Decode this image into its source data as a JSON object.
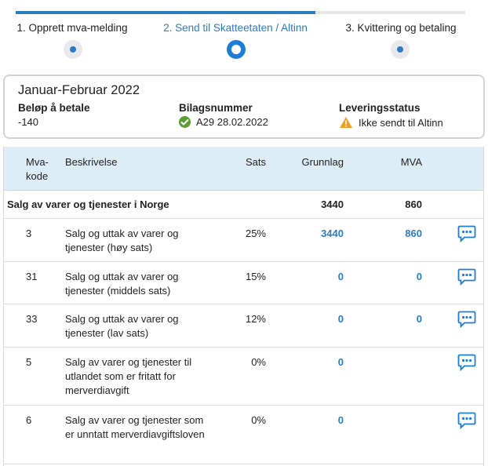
{
  "stepper": {
    "steps": [
      {
        "label": "1. Opprett mva-melding",
        "state": "done"
      },
      {
        "label": "2. Send til Skatteetaten / Altinn",
        "state": "active"
      },
      {
        "label": "3. Kvittering og betaling",
        "state": "todo"
      }
    ]
  },
  "summary": {
    "title": "Januar-Februar 2022",
    "amount_label": "Beløp å betale",
    "amount_value": "-140",
    "voucher_label": "Bilagsnummer",
    "voucher_value": "A29 28.02.2022",
    "delivery_label": "Leveringsstatus",
    "delivery_value": "Ikke sendt til Altinn"
  },
  "table": {
    "headers": {
      "kode_line1": "Mva-",
      "kode_line2": "kode",
      "beskrivelse": "Beskrivelse",
      "sats": "Sats",
      "grunnlag": "Grunnlag",
      "mva": "MVA"
    },
    "group": {
      "label": "Salg av varer og tjenester i Norge",
      "grunnlag": "3440",
      "mva": "860"
    },
    "rows": [
      {
        "kode": "3",
        "beskrivelse": "Salg og uttak av varer og tjenester (høy sats)",
        "sats": "25%",
        "grunnlag": "3440",
        "mva": "860"
      },
      {
        "kode": "31",
        "beskrivelse": "Salg og uttak av varer og tjenester (middels sats)",
        "sats": "15%",
        "grunnlag": "0",
        "mva": "0"
      },
      {
        "kode": "33",
        "beskrivelse": "Salg og uttak av varer og tjenester (lav sats)",
        "sats": "12%",
        "grunnlag": "0",
        "mva": "0"
      },
      {
        "kode": "5",
        "beskrivelse": "Salg av varer og tjenester til utlandet som er fritatt for merverdiavgift",
        "sats": "0%",
        "grunnlag": "0",
        "mva": ""
      },
      {
        "kode": "6",
        "beskrivelse": "Salg av varer og tjenester som er unntatt merverdiavgiftsloven",
        "sats": "0%",
        "grunnlag": "0",
        "mva": ""
      }
    ]
  },
  "colors": {
    "accent": "#2d7bc4",
    "header_bg": "#dcedf7",
    "success": "#5a9e35",
    "warning": "#f0a020"
  },
  "icons": {
    "ok": "check-circle-icon",
    "warning": "warning-triangle-icon",
    "comment": "comment-bubble-icon"
  }
}
